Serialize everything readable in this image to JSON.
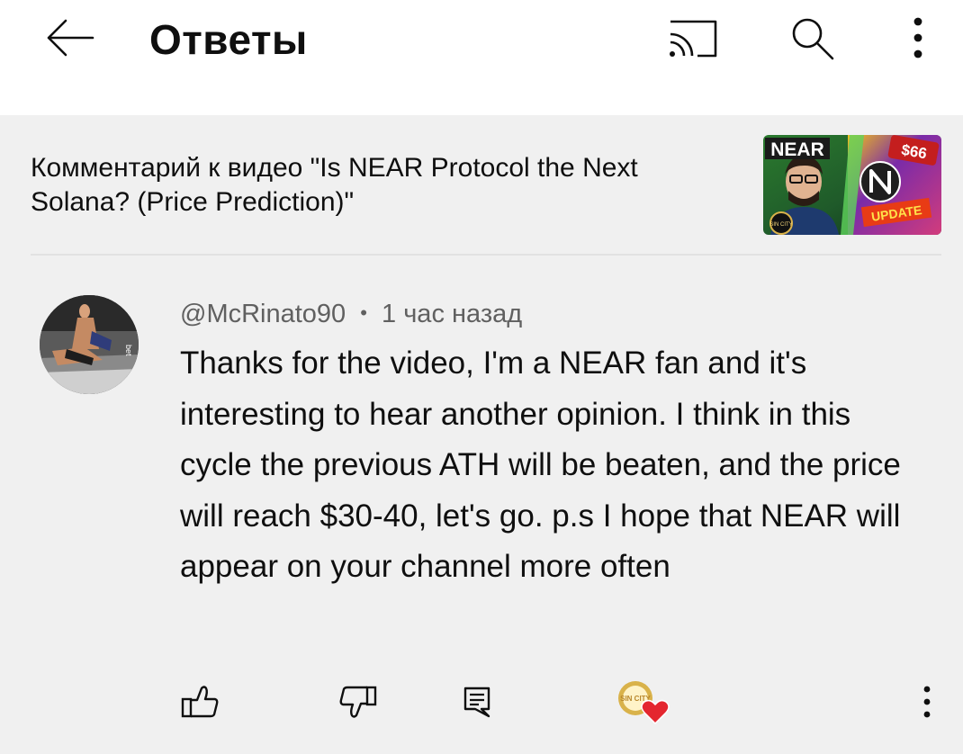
{
  "header": {
    "title": "Ответы",
    "back_icon": "arrow-left-icon",
    "cast_icon": "cast-icon",
    "search_icon": "search-icon",
    "more_icon": "more-vert-icon"
  },
  "context": {
    "text": "Комментарий к видео \"Is NEAR Protocol the Next Solana? (Price Prediction)\"",
    "thumbnail": {
      "badge_left": "NEAR",
      "badge_price": "$66",
      "badge_update": "UPDATE",
      "channel_logo_text": "SIN CITY"
    }
  },
  "comment": {
    "author": "@McRinato90",
    "separator": "•",
    "time": "1 час назад",
    "text": "Thanks for the video, I'm a NEAR fan and it's interesting to hear another opinion.  I think in this cycle the previous ATH will be beaten, and the price will reach $30-40, let's go.  p.s I hope that NEAR will appear on your channel more often"
  },
  "actions": {
    "like_icon": "thumbs-up-icon",
    "dislike_icon": "thumbs-down-icon",
    "reply_icon": "reply-icon",
    "creator_heart_logo_text": "SIN CITY",
    "more_icon": "more-vert-icon"
  },
  "colors": {
    "panel_bg": "#f0f0f0",
    "text_primary": "#0f0f0f",
    "text_secondary": "#606060",
    "heart": "#e4262f"
  }
}
